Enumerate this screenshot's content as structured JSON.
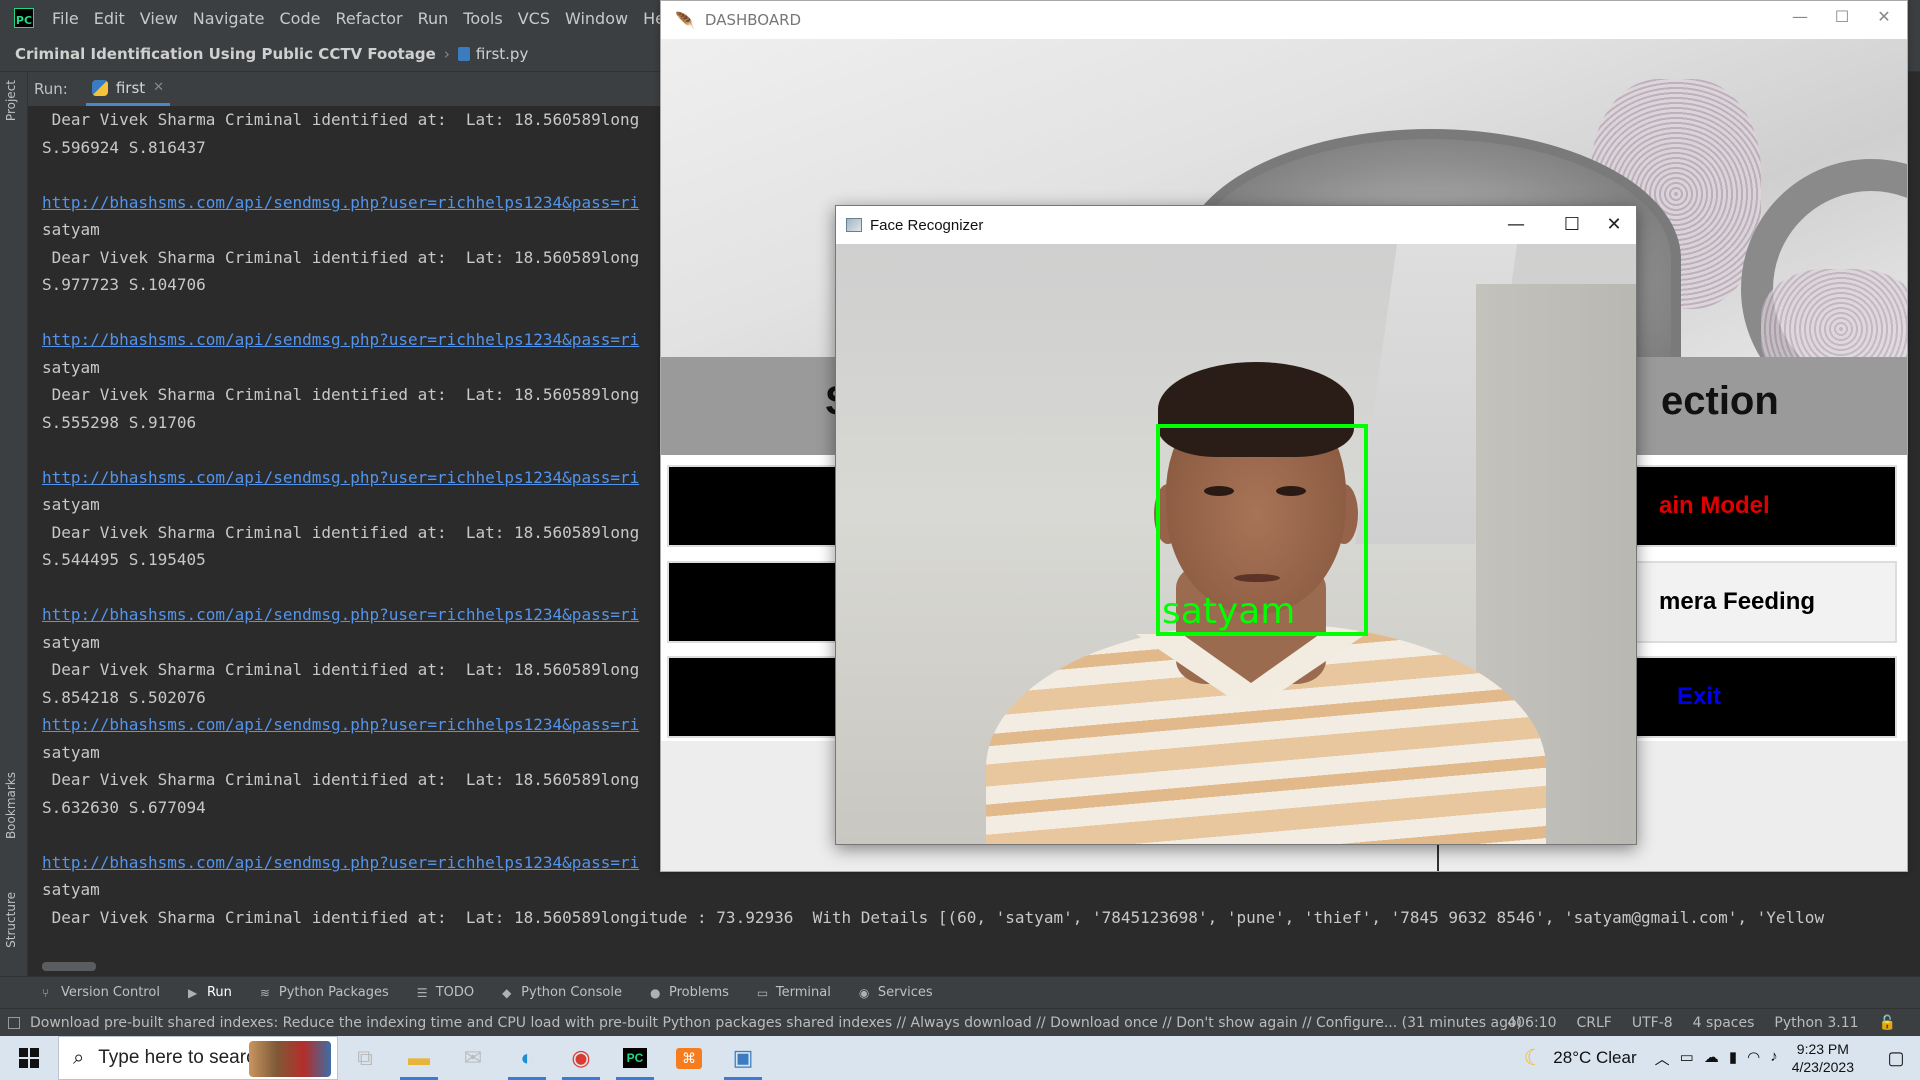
{
  "ide": {
    "menu": [
      "File",
      "Edit",
      "View",
      "Navigate",
      "Code",
      "Refactor",
      "Run",
      "Tools",
      "VCS",
      "Window",
      "Help"
    ],
    "project_name": "Criminal Identification Using Public CCTV Footage",
    "file_name": "first.py",
    "left_tabs": {
      "project": "Project",
      "bookmarks": "Bookmarks",
      "structure": "Structure"
    },
    "run_label": "Run:",
    "run_tab": "first",
    "console_lines": [
      " Dear Vivek Sharma Criminal identified at:  Lat: 18.560589long",
      "S.596924 S.816437",
      "",
      "http://bhashsms.com/api/sendmsg.php?user=richhelps1234&pass=ri",
      "satyam",
      " Dear Vivek Sharma Criminal identified at:  Lat: 18.560589long",
      "S.977723 S.104706",
      "",
      "http://bhashsms.com/api/sendmsg.php?user=richhelps1234&pass=ri",
      "satyam",
      " Dear Vivek Sharma Criminal identified at:  Lat: 18.560589long",
      "S.555298 S.91706",
      "",
      "http://bhashsms.com/api/sendmsg.php?user=richhelps1234&pass=ri",
      "satyam",
      " Dear Vivek Sharma Criminal identified at:  Lat: 18.560589long",
      "S.544495 S.195405",
      "",
      "http://bhashsms.com/api/sendmsg.php?user=richhelps1234&pass=ri",
      "satyam",
      " Dear Vivek Sharma Criminal identified at:  Lat: 18.560589long",
      "S.854218 S.502076",
      "http://bhashsms.com/api/sendmsg.php?user=richhelps1234&pass=ri",
      "satyam",
      " Dear Vivek Sharma Criminal identified at:  Lat: 18.560589long",
      "S.632630 S.677094",
      "",
      "http://bhashsms.com/api/sendmsg.php?user=richhelps1234&pass=ri",
      "satyam",
      " Dear Vivek Sharma Criminal identified at:  Lat: 18.560589longitude : 73.92936  With Details [(60, 'satyam', '7845123698', 'pune', 'thief', '7845 9632 8546', 'satyam@gmail.com', 'Yellow"
    ],
    "bottom_tools": [
      {
        "label": "Version Control",
        "icon": "branch-icon"
      },
      {
        "label": "Run",
        "icon": "play-icon",
        "active": true
      },
      {
        "label": "Python Packages",
        "icon": "layers-icon"
      },
      {
        "label": "TODO",
        "icon": "list-icon"
      },
      {
        "label": "Python Console",
        "icon": "python-icon"
      },
      {
        "label": "Problems",
        "icon": "info-icon"
      },
      {
        "label": "Terminal",
        "icon": "terminal-icon"
      },
      {
        "label": "Services",
        "icon": "services-icon"
      }
    ],
    "status_message": "Download pre-built shared indexes: Reduce the indexing time and CPU load with pre-built Python packages shared indexes // Always download // Download once // Don't show again // Configure... (31 minutes ago)",
    "status_right": {
      "position": "406:10",
      "line_sep": "CRLF",
      "encoding": "UTF-8",
      "indent": "4 spaces",
      "interpreter": "Python 3.11"
    },
    "colors": {
      "link": "#5394ec",
      "text": "#c8c8c8",
      "bg": "#2b2b2b"
    }
  },
  "dashboard": {
    "title": "DASHBOARD",
    "heading_right": "ection",
    "heading_left": "S",
    "buttons": [
      {
        "label": "ain Model",
        "color": "#e00000"
      },
      {
        "label": "mera Feeding",
        "color": "#000000"
      },
      {
        "label": "Exit",
        "color": "#0000ee"
      }
    ]
  },
  "face_window": {
    "title": "Face Recognizer",
    "detected_label": "satyam",
    "box_color": "#00ff00"
  },
  "taskbar": {
    "search_placeholder": "Type here to search",
    "weather": "28°C  Clear",
    "time": "9:23 PM",
    "date": "4/23/2023"
  }
}
